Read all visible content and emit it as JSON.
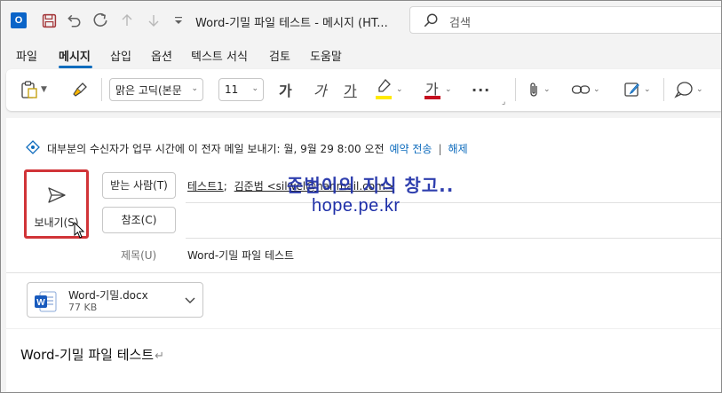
{
  "window": {
    "title": "Word-기밀 파일 테스트  -  메시지 (HT...",
    "search_placeholder": "검색"
  },
  "menu": {
    "tabs": [
      "파일",
      "메시지",
      "삽입",
      "옵션",
      "텍스트 서식",
      "검토",
      "도움말"
    ],
    "active": "메시지"
  },
  "ribbon": {
    "font_name": "맑은 고딕(본문",
    "font_size": "11",
    "bold_glyph": "가",
    "italic_glyph": "가",
    "underline_glyph": "가",
    "font_color_glyph": "가",
    "more": "···"
  },
  "notice": {
    "text": "대부분의 수신자가 업무 시간에 이 전자 메일 보내기: 월, 9월 29 8:00 오전",
    "schedule_link": "예약 전송",
    "separator": "|",
    "dismiss_link": "해제"
  },
  "send": {
    "label": "보내기(S)"
  },
  "to": {
    "button": "받는 사람(T)",
    "recipients": [
      "테스트1",
      "김준범 <silwel@hanmail.com>"
    ]
  },
  "cc": {
    "button": "참조(C)"
  },
  "subject": {
    "label": "제목(U)",
    "value": "Word-기밀 파일 테스트"
  },
  "attachment": {
    "name": "Word-기밀.docx",
    "size": "77 KB"
  },
  "body": {
    "text": "Word-기밀 파일 테스트"
  },
  "watermark": {
    "line1": "준범이의 지식 창고..",
    "line2": "hope.pe.kr"
  },
  "colors": {
    "accent": "#0f6cbd",
    "send_highlight": "#d13438",
    "highlighter": "#ffea00",
    "font_color": "#c50f1f",
    "watermark": "#1e2fa8"
  }
}
